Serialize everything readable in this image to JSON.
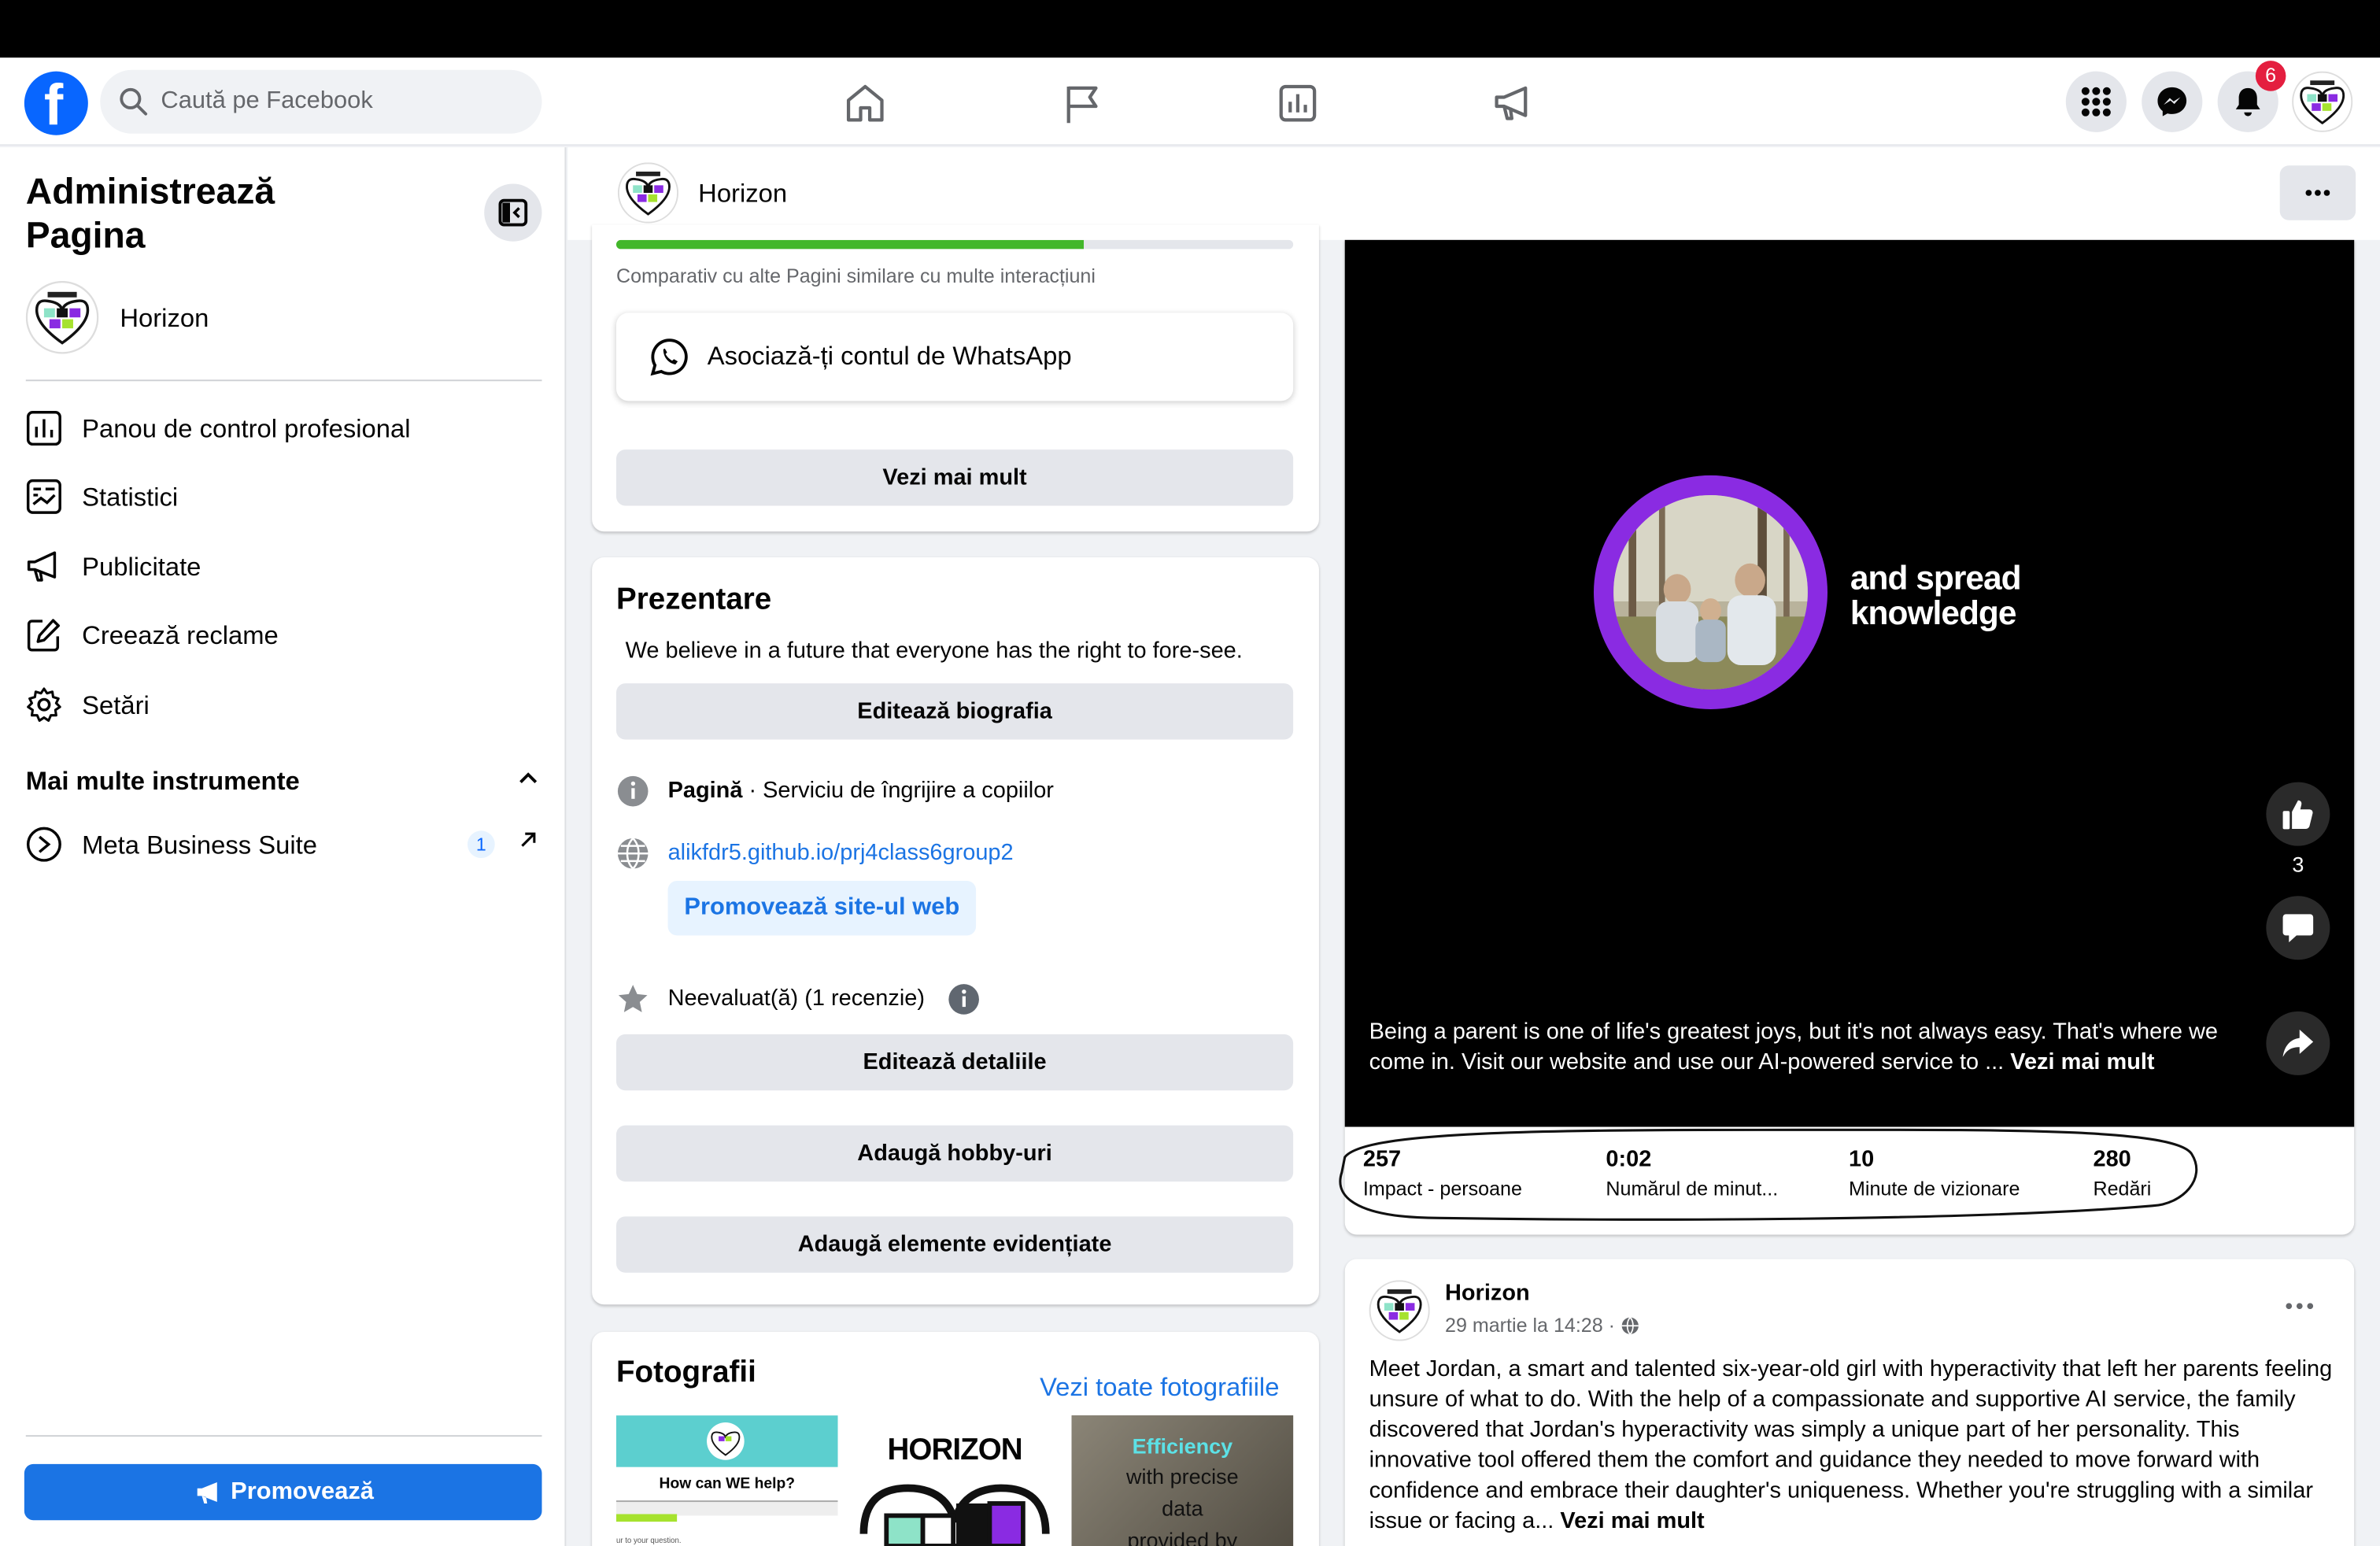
{
  "topbar": {
    "search_placeholder": "Caută pe Facebook",
    "notification_count": "6"
  },
  "sidebar": {
    "title": "Administrează Pagina",
    "page_name": "Horizon",
    "items": [
      {
        "label": "Panou de control profesional",
        "icon": "dashboard-icon"
      },
      {
        "label": "Statistici",
        "icon": "insights-icon"
      },
      {
        "label": "Publicitate",
        "icon": "megaphone-icon"
      },
      {
        "label": "Creează reclame",
        "icon": "edit-icon"
      },
      {
        "label": "Setări",
        "icon": "gear-icon"
      }
    ],
    "more_tools": "Mai multe instrumente",
    "meta_business": "Meta Business Suite",
    "meta_badge": "1",
    "promote": "Promovează"
  },
  "page_header": {
    "name": "Horizon"
  },
  "middle": {
    "progress_fraction": 0.69,
    "compare_text": "Comparativ cu alte Pagini similare cu multe interacțiuni",
    "whatsapp": "Asociază-ți contul de WhatsApp",
    "see_more": "Vezi mai mult",
    "intro_title": "Prezentare",
    "bio": "We believe in a future that everyone has the right to fore-see.",
    "edit_bio": "Editează biografia",
    "page_type_bold": "Pagină",
    "page_type_rest": " · Serviciu de îngrijire a copiilor",
    "website": "alikfdr5.github.io/prj4class6group2",
    "promote_web": "Promovează site-ul web",
    "rating": "Neevaluat(ă) (1 recenzie)",
    "edit_details": "Editează detaliile",
    "add_hobbies": "Adaugă hobby-uri",
    "add_featured": "Adaugă elemente evidențiate",
    "photos_title": "Fotografii",
    "see_all_photos": "Vezi toate fotografiile",
    "thumb1_text": "How can WE help?",
    "thumb1_small": "ur to your question.",
    "thumb2_text": "HORIZON",
    "thumb3_line1": "Efficiency",
    "thumb3_line2": "with precise",
    "thumb3_line3": "data",
    "thumb3_line4": "provided by"
  },
  "video": {
    "slogan_line1": "and spread",
    "slogan_line2": "knowledge",
    "caption": "Being a parent is one of life's greatest joys, but it's not always easy. That's where we come in. Visit our website and use our AI-powered service to ... ",
    "caption_more": "Vezi mai mult",
    "like_count": "3",
    "stats": [
      {
        "value": "257",
        "label": "Impact - persoane"
      },
      {
        "value": "0:02",
        "label": "Numărul de minut..."
      },
      {
        "value": "10",
        "label": "Minute de vizionare"
      },
      {
        "value": "280",
        "label": "Redări"
      }
    ]
  },
  "post": {
    "author": "Horizon",
    "date": "29 martie la 14:28 · ",
    "text": "Meet Jordan, a smart and talented six-year-old girl with hyperactivity that left her parents feeling unsure of what to do. With the help of a compassionate and supportive AI service, the family discovered that Jordan's hyperactivity was simply a unique part of her personality. This innovative tool offered them the comfort and guidance they needed to move forward with confidence and embrace their daughter's uniqueness. Whether you're struggling with a similar issue or facing a... ",
    "more": "Vezi mai mult"
  },
  "colors": {
    "brand": "#0866ff",
    "accent": "#8a2be2",
    "badge": "#e41e3f",
    "progress": "#42b72a"
  }
}
